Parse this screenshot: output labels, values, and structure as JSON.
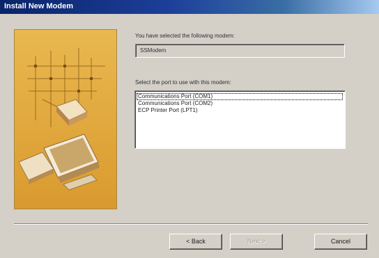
{
  "window": {
    "title": "Install New Modem"
  },
  "side_image": {
    "icon": "modem-computer-illustration",
    "background": "#e6b247"
  },
  "selected_modem": {
    "label": "You have selected the following modem:",
    "value": "SSModem"
  },
  "port_select": {
    "label": "Select the port to use with this modem:",
    "items": [
      {
        "label": "Communications Port (COM1)",
        "selected": true
      },
      {
        "label": "Communications Port (COM2)",
        "selected": false
      },
      {
        "label": "ECP Printer Port (LPT1)",
        "selected": false
      }
    ]
  },
  "buttons": {
    "back": "< Back",
    "next": "Next >",
    "cancel": "Cancel"
  }
}
